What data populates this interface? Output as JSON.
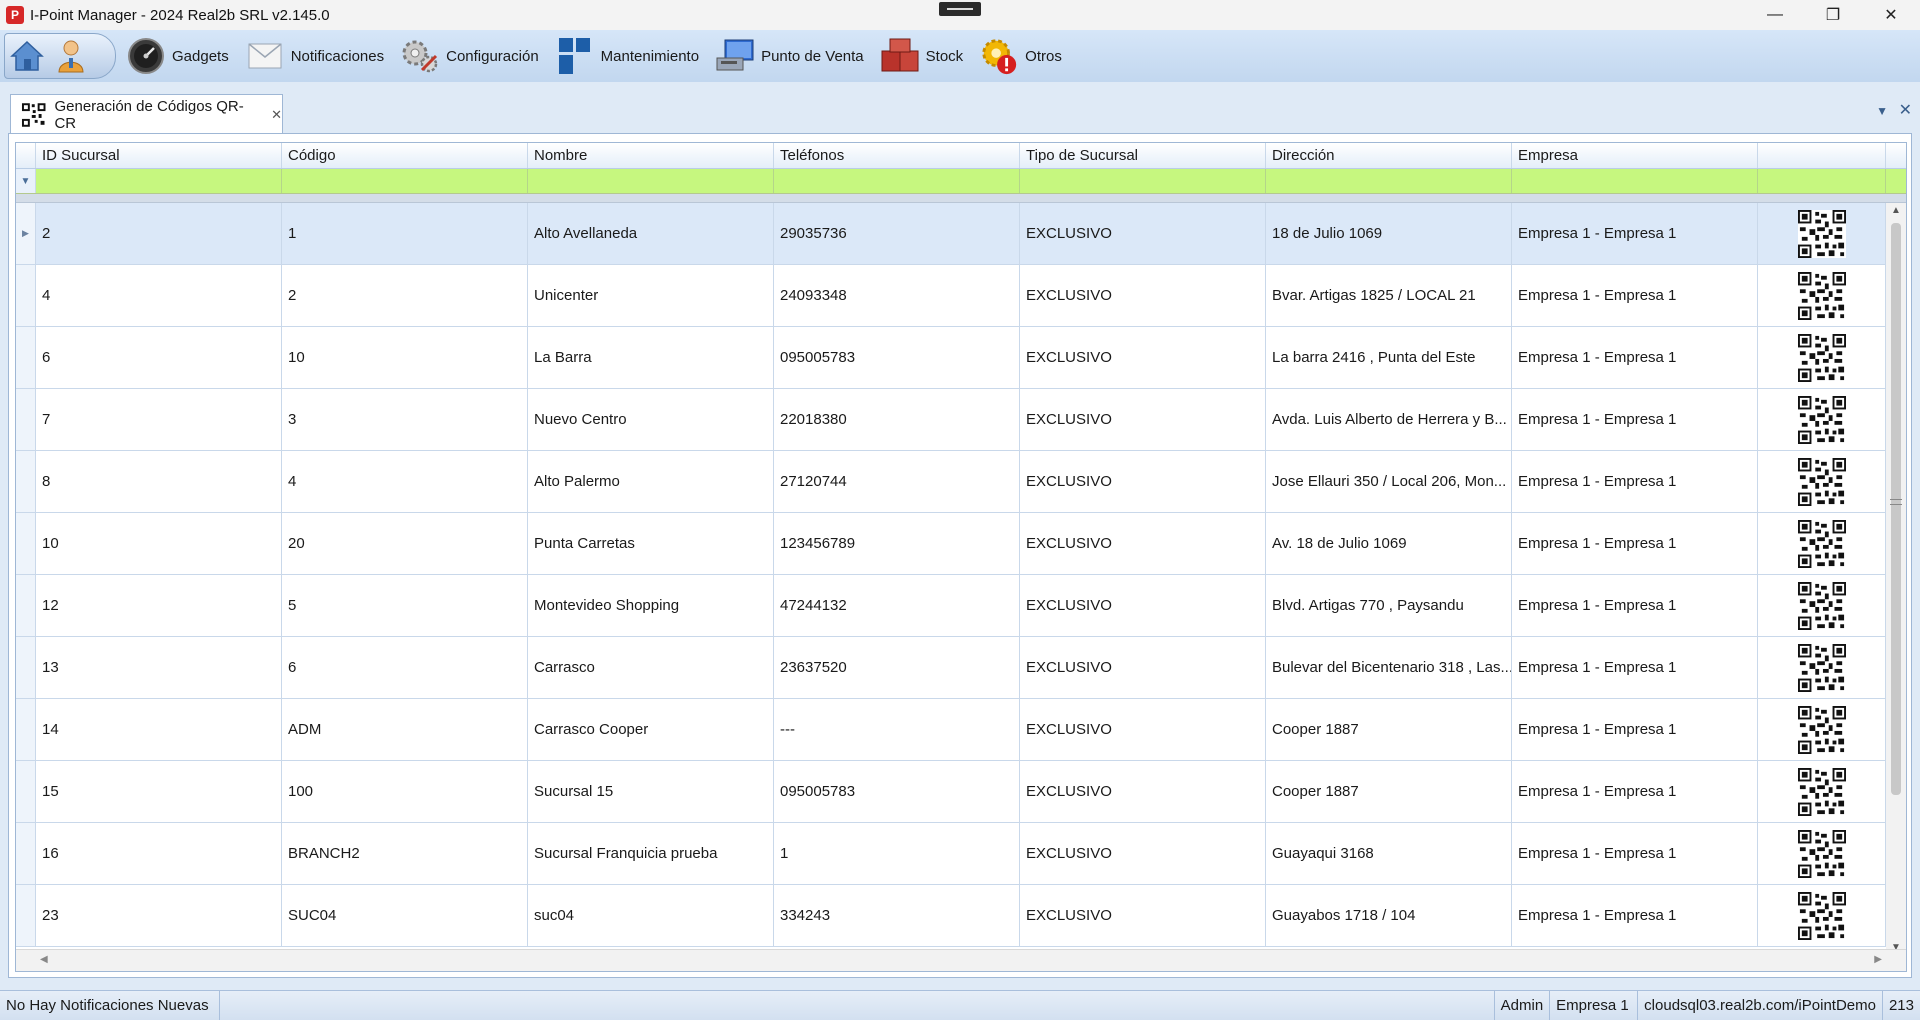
{
  "window": {
    "title": "I-Point Manager - 2024 Real2b SRL v2.145.0",
    "app_icon_letter": "P",
    "min_glyph": "—",
    "max_glyph": "❐",
    "close_glyph": "✕"
  },
  "toolbar": {
    "items": [
      {
        "label": "Gadgets",
        "icon": "gauge-icon"
      },
      {
        "label": "Notificaciones",
        "icon": "envelope-icon"
      },
      {
        "label": "Configuración",
        "icon": "gears-icon"
      },
      {
        "label": "Mantenimiento",
        "icon": "blocks-icon"
      },
      {
        "label": "Punto de Venta",
        "icon": "pos-monitor-icon"
      },
      {
        "label": "Stock",
        "icon": "boxes-icon"
      },
      {
        "label": "Otros",
        "icon": "warning-gear-icon"
      }
    ]
  },
  "tab": {
    "label": "Generación de Códigos QR-CR",
    "close_glyph": "✕"
  },
  "grid": {
    "columns": [
      "ID Sucursal",
      "Código",
      "Nombre",
      "Teléfonos",
      "Tipo de Sucursal",
      "Dirección",
      "Empresa",
      ""
    ],
    "rows": [
      {
        "id": "2",
        "codigo": "1",
        "nombre": "Alto Avellaneda",
        "telefonos": "29035736",
        "tipo": "EXCLUSIVO",
        "direccion": "18 de Julio 1069",
        "empresa": "Empresa 1 - Empresa 1"
      },
      {
        "id": "4",
        "codigo": "2",
        "nombre": "Unicenter",
        "telefonos": "24093348",
        "tipo": "EXCLUSIVO",
        "direccion": "Bvar. Artigas 1825  / LOCAL 21",
        "empresa": "Empresa 1 - Empresa 1"
      },
      {
        "id": "6",
        "codigo": "10",
        "nombre": "La Barra",
        "telefonos": "095005783",
        "tipo": "EXCLUSIVO",
        "direccion": "La barra 2416 , Punta del Este",
        "empresa": "Empresa 1 - Empresa 1"
      },
      {
        "id": "7",
        "codigo": "3",
        "nombre": "Nuevo Centro",
        "telefonos": "22018380",
        "tipo": "EXCLUSIVO",
        "direccion": "Avda. Luis Alberto de Herrera y B...",
        "empresa": "Empresa 1 - Empresa 1"
      },
      {
        "id": "8",
        "codigo": "4",
        "nombre": "Alto Palermo",
        "telefonos": "27120744",
        "tipo": "EXCLUSIVO",
        "direccion": "Jose Ellauri 350  / Local 206, Mon...",
        "empresa": "Empresa 1 - Empresa 1"
      },
      {
        "id": "10",
        "codigo": "20",
        "nombre": "Punta Carretas",
        "telefonos": "123456789",
        "tipo": "EXCLUSIVO",
        "direccion": "Av. 18 de Julio 1069",
        "empresa": "Empresa 1 - Empresa 1"
      },
      {
        "id": "12",
        "codigo": "5",
        "nombre": "Montevideo Shopping",
        "telefonos": "47244132",
        "tipo": "EXCLUSIVO",
        "direccion": "Blvd. Artigas 770 , Paysandu",
        "empresa": "Empresa 1 - Empresa 1"
      },
      {
        "id": "13",
        "codigo": "6",
        "nombre": "Carrasco",
        "telefonos": "23637520",
        "tipo": "EXCLUSIVO",
        "direccion": "Bulevar del Bicentenario 318 , Las...",
        "empresa": "Empresa 1 - Empresa 1"
      },
      {
        "id": "14",
        "codigo": "ADM",
        "nombre": "Carrasco Cooper",
        "telefonos": "---",
        "tipo": "EXCLUSIVO",
        "direccion": "Cooper 1887",
        "empresa": "Empresa 1 - Empresa 1"
      },
      {
        "id": "15",
        "codigo": "100",
        "nombre": "Sucursal 15",
        "telefonos": "095005783",
        "tipo": "EXCLUSIVO",
        "direccion": "Cooper 1887",
        "empresa": "Empresa 1 - Empresa 1"
      },
      {
        "id": "16",
        "codigo": "BRANCH2",
        "nombre": "Sucursal Franquicia prueba",
        "telefonos": "1",
        "tipo": "EXCLUSIVO",
        "direccion": "Guayaqui 3168",
        "empresa": "Empresa 1 - Empresa 1"
      },
      {
        "id": "23",
        "codigo": "SUC04",
        "nombre": "suc04",
        "telefonos": "334243",
        "tipo": "EXCLUSIVO",
        "direccion": "Guayabos 1718  / 104",
        "empresa": "Empresa 1 - Empresa 1"
      }
    ],
    "selected_row": 0
  },
  "status": {
    "notifications": "No Hay Notificaciones Nuevas",
    "user": "Admin",
    "company": "Empresa 1",
    "server": "cloudsql03.real2b.com/iPointDemo",
    "number": "213"
  },
  "colors": {
    "filter_row": "#c6f77f",
    "selected_row": "#dbe8f8",
    "toolbar": "#c2d7ef"
  }
}
